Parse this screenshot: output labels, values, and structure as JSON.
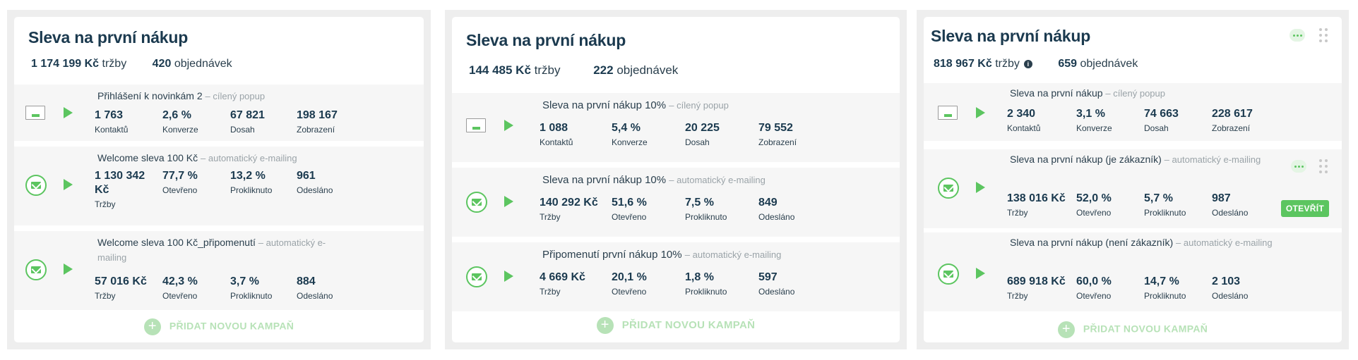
{
  "colors": {
    "accent": "#5cc560",
    "accent_light": "#b7e2b7",
    "title": "#1b3a4f",
    "row_bg": "#f6f6f6"
  },
  "panels": [
    {
      "title": "Sleva na první nákup",
      "revenue": "1 174 199 Kč",
      "revenue_label": "tržby",
      "orders": "420",
      "orders_label": "objednávek",
      "campaigns": [
        {
          "name": "Přihlášení k novinkám 2",
          "type": "– cílený popup",
          "m": [
            {
              "v": "1 763",
              "l": "Kontaktů"
            },
            {
              "v": "2,6 %",
              "l": "Konverze"
            },
            {
              "v": "67 821",
              "l": "Dosah"
            },
            {
              "v": "198 167",
              "l": "Zobrazení"
            }
          ]
        },
        {
          "name": "Welcome sleva 100 Kč",
          "type": "– automatický e-mailing",
          "m": [
            {
              "v": "1 130 342 Kč",
              "l": "Tržby"
            },
            {
              "v": "77,7 %",
              "l": "Otevřeno"
            },
            {
              "v": "13,2 %",
              "l": "Prokliknuto"
            },
            {
              "v": "961",
              "l": "Odesláno"
            }
          ]
        },
        {
          "name": "Welcome sleva 100 Kč_připomenutí",
          "type": "– automatický e-mailing",
          "m": [
            {
              "v": "57 016 Kč",
              "l": "Tržby"
            },
            {
              "v": "42,3 %",
              "l": "Otevřeno"
            },
            {
              "v": "3,7 %",
              "l": "Prokliknuto"
            },
            {
              "v": "884",
              "l": "Odesláno"
            }
          ]
        }
      ],
      "add_label": "PŘIDAT NOVOU KAMPAŇ"
    },
    {
      "title": "Sleva na první nákup",
      "revenue": "144 485 Kč",
      "revenue_label": "tržby",
      "orders": "222",
      "orders_label": "objednávek",
      "campaigns": [
        {
          "name": "Sleva na první nákup 10%",
          "type": "– cílený popup",
          "m": [
            {
              "v": "1 088",
              "l": "Kontaktů"
            },
            {
              "v": "5,4 %",
              "l": "Konverze"
            },
            {
              "v": "20 225",
              "l": "Dosah"
            },
            {
              "v": "79 552",
              "l": "Zobrazení"
            }
          ]
        },
        {
          "name": "Sleva na první nákup 10%",
          "type": "– automatický e-mailing",
          "m": [
            {
              "v": "140 292 Kč",
              "l": "Tržby"
            },
            {
              "v": "51,6 %",
              "l": "Otevřeno"
            },
            {
              "v": "7,5 %",
              "l": "Prokliknuto"
            },
            {
              "v": "849",
              "l": "Odesláno"
            }
          ]
        },
        {
          "name": "Připomenutí první nákup 10%",
          "type": "– automatický e-mailing",
          "m": [
            {
              "v": "4 669 Kč",
              "l": "Tržby"
            },
            {
              "v": "20,1 %",
              "l": "Otevřeno"
            },
            {
              "v": "1,8 %",
              "l": "Prokliknuto"
            },
            {
              "v": "597",
              "l": "Odesláno"
            }
          ]
        }
      ],
      "add_label": "PŘIDAT NOVOU KAMPAŇ"
    },
    {
      "title": "Sleva na první nákup",
      "revenue": "818 967 Kč",
      "revenue_label": "tržby",
      "orders": "659",
      "orders_label": "objednávek",
      "campaigns": [
        {
          "name": "Sleva na první nákup",
          "type": "– cílený popup",
          "m": [
            {
              "v": "2 340",
              "l": "Kontaktů"
            },
            {
              "v": "3,1 %",
              "l": "Konverze"
            },
            {
              "v": "74 663",
              "l": "Dosah"
            },
            {
              "v": "228 617",
              "l": "Zobrazení"
            }
          ]
        },
        {
          "name": "Sleva na první nákup (je zákazník)",
          "type": "– automatický e-mailing",
          "m": [
            {
              "v": "138 016 Kč",
              "l": "Tržby"
            },
            {
              "v": "52,0 %",
              "l": "Otevřeno"
            },
            {
              "v": "5,7 %",
              "l": "Prokliknuto"
            },
            {
              "v": "987",
              "l": "Odesláno"
            }
          ]
        },
        {
          "name": "Sleva na první nákup (není zákazník)",
          "type": "– automatický e-mailing",
          "m": [
            {
              "v": "689 918 Kč",
              "l": "Tržby"
            },
            {
              "v": "60,0 %",
              "l": "Otevřeno"
            },
            {
              "v": "14,7 %",
              "l": "Prokliknuto"
            },
            {
              "v": "2 103",
              "l": "Odesláno"
            }
          ]
        }
      ],
      "open_label": "OTEVŘÍT",
      "add_label": "PŘIDAT NOVOU KAMPAŇ"
    }
  ]
}
